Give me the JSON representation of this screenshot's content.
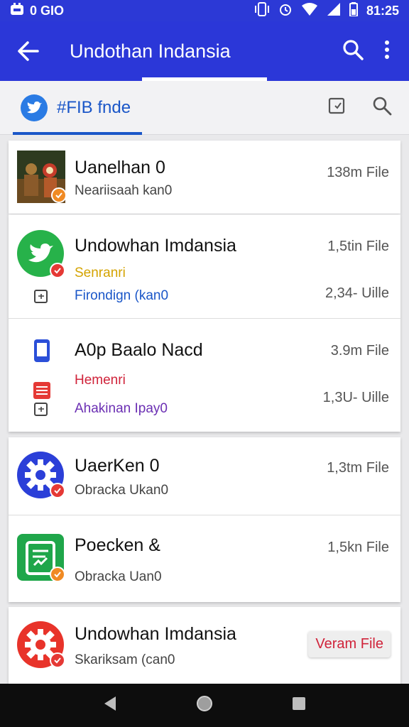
{
  "status_bar": {
    "left_text": "0 GIO",
    "time": "81:25"
  },
  "app_bar": {
    "title": "Undothan Indansia"
  },
  "tab": {
    "label": "#FIB fnde"
  },
  "colors": {
    "primary": "#2b37d8",
    "tab_accent": "#1a56c8",
    "badge_red": "#e53935",
    "badge_orange": "#f08a24"
  },
  "cards": [
    {
      "rows": [
        {
          "icon": "photo-thumbnail-icon",
          "name": "Uanelhan 0",
          "sub": "Neariisaah kan0",
          "meta": "138m File"
        }
      ]
    },
    {
      "rows": [
        {
          "icon": "twitter-bird-icon",
          "name": "Undowhan Imdansia",
          "sub1": "Senranri",
          "sub1_color": "#d4a300",
          "sub2": "Firondign (kan0",
          "sub2_color": "#1a56c8",
          "meta1": "1,5tin File",
          "meta2": "2,34- Uille"
        },
        {
          "icon": "phone-icon",
          "name": "A0p Baalo Nacd",
          "sub1": "Hemenri",
          "sub1_color": "#d0233a",
          "sub2": "Ahakinan Ipay0",
          "sub2_color": "#6b2fb3",
          "meta1": "3.9m File",
          "meta2": "1,3U- Uille"
        }
      ]
    },
    {
      "rows": [
        {
          "icon": "gear-icon",
          "name": "UaerKen 0",
          "sub": "Obracka Ukan0",
          "meta": "1,3tm File"
        },
        {
          "icon": "document-app-icon",
          "name": "Poecken &",
          "sub": "Obracka Uan0",
          "meta": "1,5kn File"
        }
      ]
    },
    {
      "rows": [
        {
          "icon": "gear-red-icon",
          "name": "Undowhan Imdansia",
          "sub": "Skariksam (can0",
          "button": "Veram File"
        }
      ]
    }
  ]
}
